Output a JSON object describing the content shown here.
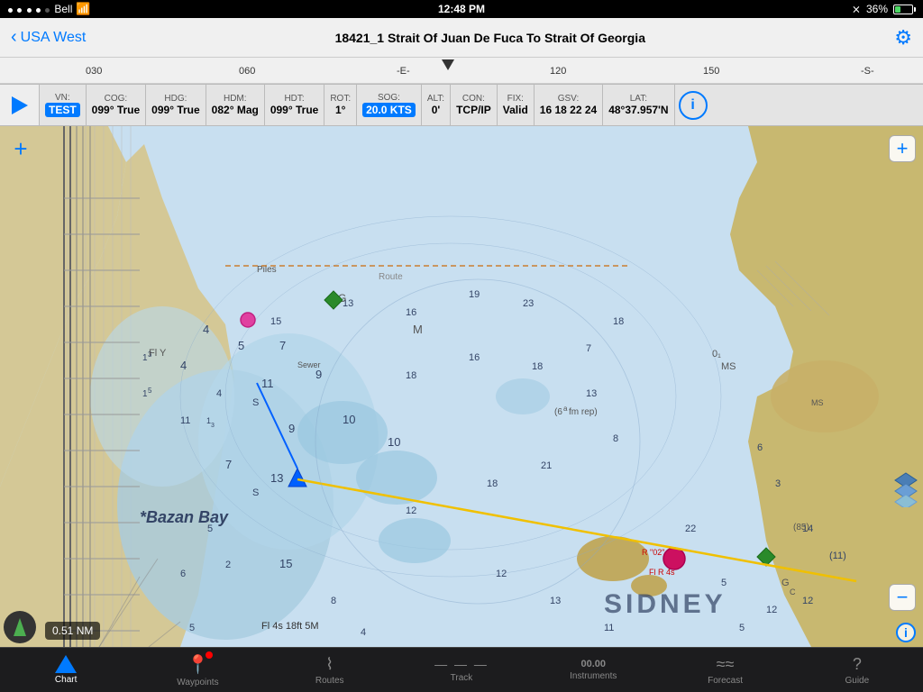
{
  "statusBar": {
    "carrier": "Bell",
    "time": "12:48 PM",
    "batteryPct": "36%"
  },
  "navBar": {
    "backLabel": "USA West",
    "title": "18421_1 Strait Of Juan De Fuca To Strait Of Georgia"
  },
  "ruler": {
    "ticks": [
      "030",
      "060",
      "-E-",
      "120",
      "150",
      "-S-"
    ]
  },
  "dataStrip": {
    "cells": [
      {
        "label": "VN:",
        "value": "TEST",
        "highlight": true
      },
      {
        "label": "COG:",
        "value": "099° True"
      },
      {
        "label": "HDG:",
        "value": "099° True"
      },
      {
        "label": "HDM:",
        "value": "082° Mag"
      },
      {
        "label": "HDT:",
        "value": "099° True"
      },
      {
        "label": "ROT:",
        "value": "1°"
      },
      {
        "label": "SOG:",
        "value": "20.0 KTS",
        "highlight": true
      },
      {
        "label": "ALT:",
        "value": "0'"
      },
      {
        "label": "CON:",
        "value": "TCP/IP"
      },
      {
        "label": "FIX:",
        "value": "Valid"
      },
      {
        "label": "GSV:",
        "value": "16 18 22 24"
      },
      {
        "label": "LAT:",
        "value": "48°37.957'N"
      }
    ]
  },
  "chartArea": {
    "mapLabel": "Bazan Bay",
    "lightLabel1": "Fl Y",
    "lightLabel2": "Fl 4s 18ft 5M",
    "scaleLabel": "0.51 NM"
  },
  "controls": {
    "zoomPlus": "+",
    "zoomMinus": "−",
    "addLabel": "+"
  },
  "tabBar": {
    "tabs": [
      {
        "id": "chart",
        "label": "Chart",
        "icon": "chart"
      },
      {
        "id": "waypoints",
        "label": "Waypoints",
        "icon": "wp"
      },
      {
        "id": "routes",
        "label": "Routes",
        "icon": "routes"
      },
      {
        "id": "track",
        "label": "Track",
        "icon": "track"
      },
      {
        "id": "instruments",
        "label": "Instruments",
        "icon": "inst"
      },
      {
        "id": "forecast",
        "label": "Forecast",
        "icon": "forecast"
      },
      {
        "id": "guide",
        "label": "Guide",
        "icon": "guide"
      }
    ],
    "activeTab": "chart"
  }
}
